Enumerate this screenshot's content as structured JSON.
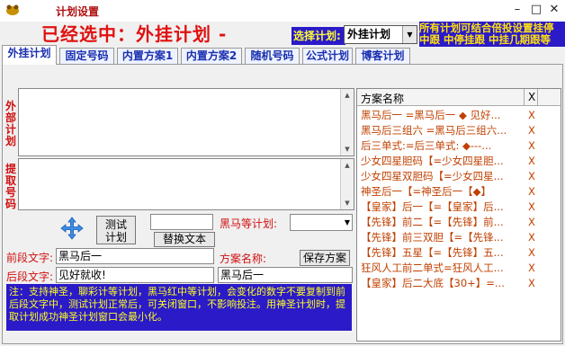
{
  "window": {
    "title": "计划设置"
  },
  "header": {
    "selected_text": "已经选中：外挂计划  -",
    "plan_select_label": "选择计划:",
    "plan_select_value": "外挂计划",
    "notice_line1": "所有计划可结合倍投设置挂停",
    "notice_line2": "中跟  中停挂跟  中挂几期跟等"
  },
  "tabs": [
    "外挂计划",
    "固定号码",
    "内置方案1",
    "内置方案2",
    "随机号码",
    "公式计划",
    "博客计划"
  ],
  "left": {
    "outer_plan_label": "外部计划",
    "extract_label": "提取号码"
  },
  "controls": {
    "test_plan_label_1": "测试",
    "test_plan_label_2": "计划",
    "replace_text_label": "替换文本",
    "plan_type_label": "黑马等计划:",
    "prefix_label": "前段文字:",
    "prefix_value": "黑马后一",
    "suffix_label": "后段文字:",
    "suffix_value": "见好就收!",
    "scheme_name_label": "方案名称:",
    "scheme_name_value": "黑马后一",
    "save_label": "保存方案"
  },
  "note": "注：支持神圣，聊彩计等计划，黑马红中等计划，会变化的数字不要复制到前后段文字中，测试计划正常后，可关闭窗口，不影响投注。用神圣计划时，提取计划成功神圣计划窗口会最小化。",
  "list": {
    "col_name": "方案名称",
    "col_del": "X",
    "rows": [
      {
        "name": "黑马后一 =黑马后一 ◆ 见好...",
        "del": "X"
      },
      {
        "name": "黑马后三组六 =黑马后三组六...",
        "del": "X"
      },
      {
        "name": "后三单式:=后三单式: ◆---...",
        "del": "X"
      },
      {
        "name": "少女四星胆码【=少女四星胆...",
        "del": "X"
      },
      {
        "name": "少女四星双胆码【=少女四星...",
        "del": "X"
      },
      {
        "name": "神圣后一【=神圣后一【◆】",
        "del": "X"
      },
      {
        "name": "【皇家】后一【=【皇家】后...",
        "del": "X"
      },
      {
        "name": "【先锋】前二【=【先锋】前...",
        "del": "X"
      },
      {
        "name": "【先锋】前三双胆【=【先锋...",
        "del": "X"
      },
      {
        "name": "【先锋】五星【=【先锋】五...",
        "del": "X"
      },
      {
        "name": "狂风人工前二单式=狂风人工...",
        "del": "X"
      },
      {
        "name": "【皇家】后二大底【30+】=...",
        "del": "X"
      }
    ]
  }
}
